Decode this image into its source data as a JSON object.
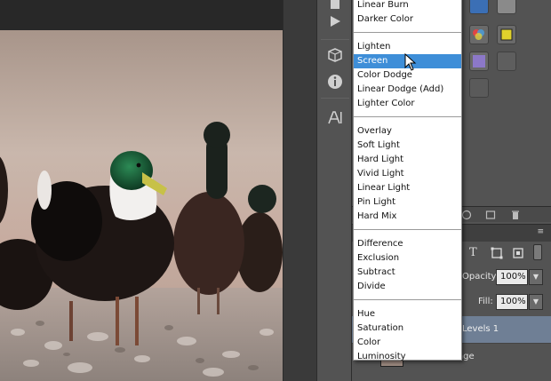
{
  "blend_menu": {
    "groups": [
      {
        "items": [
          {
            "label": "Linear Burn",
            "selected": false
          },
          {
            "label": "Darker Color",
            "selected": false
          }
        ]
      },
      {
        "items": [
          {
            "label": "Lighten",
            "selected": false
          },
          {
            "label": "Screen",
            "selected": true
          },
          {
            "label": "Color Dodge",
            "selected": false
          },
          {
            "label": "Linear Dodge (Add)",
            "selected": false
          },
          {
            "label": "Lighter Color",
            "selected": false
          }
        ]
      },
      {
        "items": [
          {
            "label": "Overlay",
            "selected": false
          },
          {
            "label": "Soft Light",
            "selected": false
          },
          {
            "label": "Hard Light",
            "selected": false
          },
          {
            "label": "Vivid Light",
            "selected": false
          },
          {
            "label": "Linear Light",
            "selected": false
          },
          {
            "label": "Pin Light",
            "selected": false
          },
          {
            "label": "Hard Mix",
            "selected": false
          }
        ]
      },
      {
        "items": [
          {
            "label": "Difference",
            "selected": false
          },
          {
            "label": "Exclusion",
            "selected": false
          },
          {
            "label": "Subtract",
            "selected": false
          },
          {
            "label": "Divide",
            "selected": false
          }
        ]
      },
      {
        "items": [
          {
            "label": "Hue",
            "selected": false
          },
          {
            "label": "Saturation",
            "selected": false
          },
          {
            "label": "Color",
            "selected": false
          },
          {
            "label": "Luminosity",
            "selected": false
          }
        ]
      }
    ],
    "selection_color": "#3e8ed8"
  },
  "layers": {
    "opacity_label": "Opacity:",
    "opacity_value": "100%",
    "fill_label": "Fill:",
    "fill_value": "100%",
    "layer_levels": "Levels 1",
    "layer_original": "Original Image",
    "filter_icon": "type-filter-icon"
  },
  "tools": {
    "icons": [
      "play-icon",
      "3d-cube-icon",
      "info-icon",
      "type-A-icon"
    ]
  },
  "colors": {
    "panel": "#535353",
    "canvas": "#282828",
    "menu_bg": "#ffffff"
  }
}
